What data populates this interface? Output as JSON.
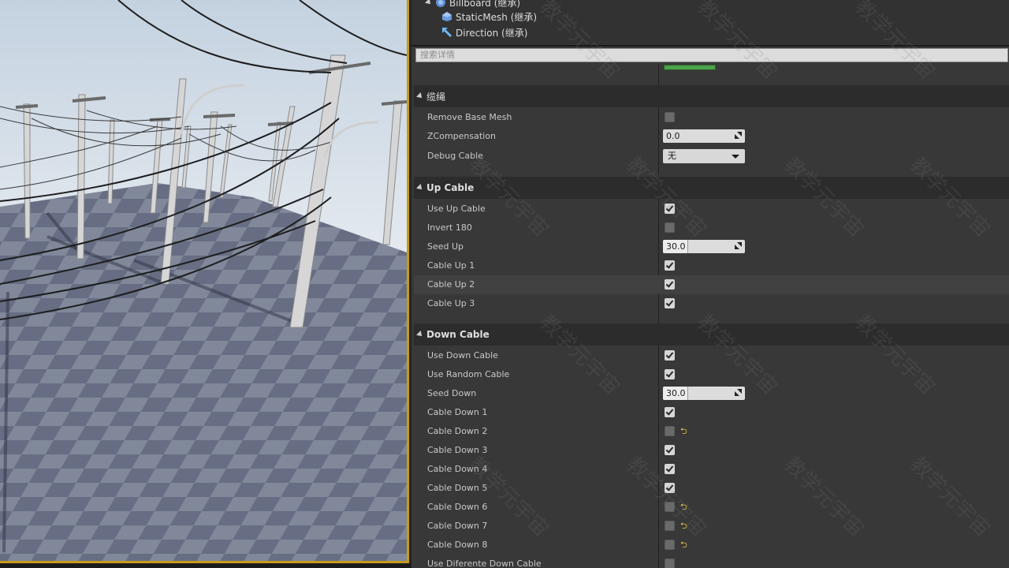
{
  "tree": {
    "items": [
      {
        "label": "Billboard (继承)",
        "icon": "billboard-icon"
      },
      {
        "label": "StaticMesh (继承)",
        "icon": "static-mesh-icon"
      },
      {
        "label": "Direction (继承)",
        "icon": "arrow-component-icon"
      }
    ]
  },
  "search": {
    "placeholder": "搜索详情"
  },
  "sections": {
    "cable": {
      "title": "缆绳",
      "remove_base_mesh": {
        "label": "Remove Base Mesh",
        "checked": false
      },
      "zcompensation": {
        "label": "ZCompensation",
        "value": "0.0"
      },
      "debug_cable": {
        "label": "Debug Cable",
        "value": "无"
      }
    },
    "up": {
      "title": "Up Cable",
      "use_up_cable": {
        "label": "Use Up Cable",
        "checked": true
      },
      "invert_180": {
        "label": "Invert 180",
        "checked": false
      },
      "seed_up": {
        "label": "Seed Up",
        "value": "30.0"
      },
      "cables": [
        {
          "label": "Cable Up 1",
          "checked": true
        },
        {
          "label": "Cable Up 2",
          "checked": true
        },
        {
          "label": "Cable Up 3",
          "checked": true
        }
      ]
    },
    "down": {
      "title": "Down Cable",
      "use_down_cable": {
        "label": "Use Down Cable",
        "checked": true
      },
      "use_random_cable": {
        "label": "Use Random Cable",
        "checked": true
      },
      "seed_down": {
        "label": "Seed Down",
        "value": "30.0"
      },
      "cables": [
        {
          "label": "Cable Down 1",
          "checked": true
        },
        {
          "label": "Cable Down 2",
          "checked": false
        },
        {
          "label": "Cable Down 3",
          "checked": true
        },
        {
          "label": "Cable Down 4",
          "checked": true
        },
        {
          "label": "Cable Down 5",
          "checked": true
        },
        {
          "label": "Cable Down 6",
          "checked": false
        },
        {
          "label": "Cable Down 7",
          "checked": false
        },
        {
          "label": "Cable Down 8",
          "checked": false
        }
      ],
      "use_different_down_cable": {
        "label": "Use Diferente Down Cable",
        "checked": false
      }
    }
  },
  "reset_icon": "reset-to-default-icon",
  "colors": {
    "accent_border": "#c69b1e",
    "panel_bg": "#383838",
    "reset_arrow": "#e3c64a",
    "color_swatch": "#4ca34a"
  }
}
